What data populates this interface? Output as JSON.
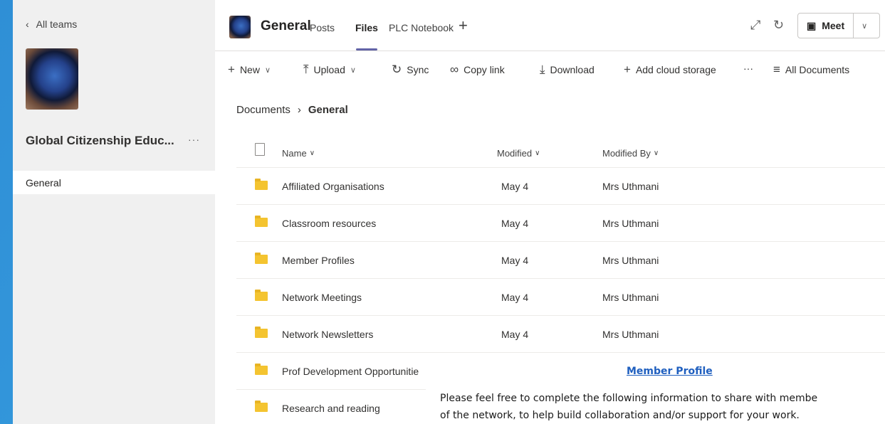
{
  "left_pane": {
    "back_label": "All teams",
    "team_name": "Global Citizenship Educ...",
    "more": "···",
    "channel": "General"
  },
  "header": {
    "title": "General",
    "tabs": [
      {
        "label": "Posts"
      },
      {
        "label": "Files",
        "active": true
      },
      {
        "label": "PLC Notebook"
      }
    ],
    "add_tab": "+",
    "meet_label": "Meet"
  },
  "toolbar": {
    "new": "New",
    "upload": "Upload",
    "sync": "Sync",
    "copy_link": "Copy link",
    "download": "Download",
    "add_cloud": "Add cloud storage",
    "more": "···",
    "view": "All Documents"
  },
  "breadcrumb": {
    "root": "Documents",
    "current": "General"
  },
  "table": {
    "headers": {
      "name": "Name",
      "modified": "Modified",
      "modified_by": "Modified By"
    },
    "rows": [
      {
        "name": "Affiliated Organisations",
        "modified": "May 4",
        "modified_by": "Mrs Uthmani"
      },
      {
        "name": "Classroom resources",
        "modified": "May 4",
        "modified_by": "Mrs Uthmani"
      },
      {
        "name": "Member Profiles",
        "modified": "May 4",
        "modified_by": "Mrs Uthmani"
      },
      {
        "name": "Network Meetings",
        "modified": "May 4",
        "modified_by": "Mrs Uthmani"
      },
      {
        "name": "Network Newsletters",
        "modified": "May 4",
        "modified_by": "Mrs Uthmani"
      },
      {
        "name": "Prof Development Opportunitie",
        "modified": "",
        "modified_by": ""
      },
      {
        "name": "Research and reading",
        "modified": "",
        "modified_by": ""
      }
    ]
  },
  "overlay": {
    "title": "Member Profile",
    "line1": "Please feel free to complete the following information to share with membe",
    "line2": "of the network, to help build collaboration and/or support for your work."
  },
  "colors": {
    "accent": "#6264a7",
    "folder": "#f4c430",
    "link": "#1f5fbf",
    "background": "#3aa3e3"
  }
}
